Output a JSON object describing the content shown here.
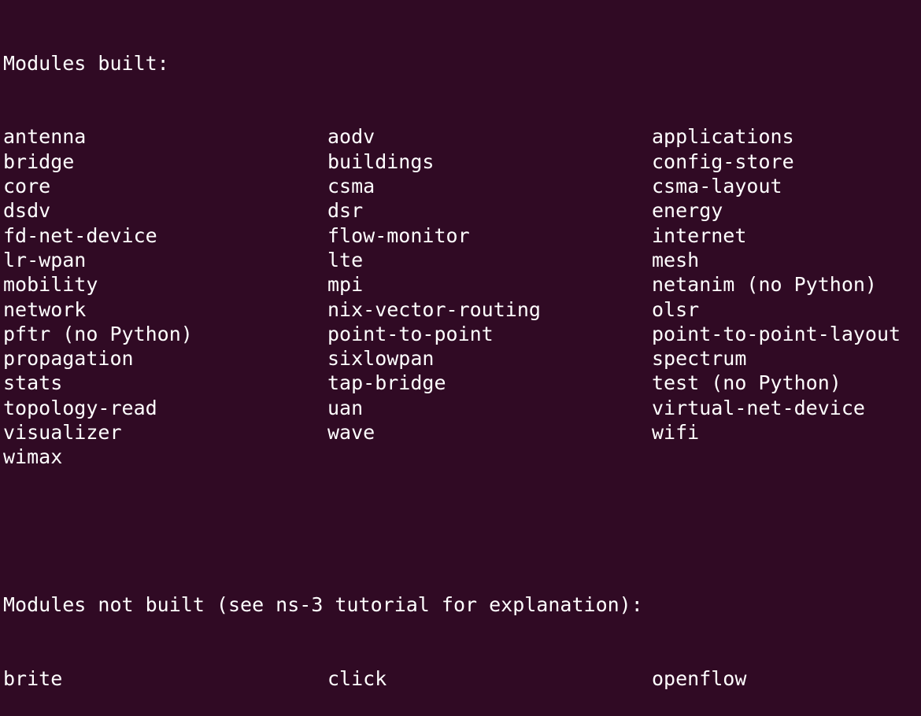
{
  "terminal": {
    "built_header": "Modules built:",
    "built_rows": [
      [
        "antenna",
        "aodv",
        "applications"
      ],
      [
        "bridge",
        "buildings",
        "config-store"
      ],
      [
        "core",
        "csma",
        "csma-layout"
      ],
      [
        "dsdv",
        "dsr",
        "energy"
      ],
      [
        "fd-net-device",
        "flow-monitor",
        "internet"
      ],
      [
        "lr-wpan",
        "lte",
        "mesh"
      ],
      [
        "mobility",
        "mpi",
        "netanim (no Python)"
      ],
      [
        "network",
        "nix-vector-routing",
        "olsr"
      ],
      [
        "pftr (no Python)",
        "point-to-point",
        "point-to-point-layout"
      ],
      [
        "propagation",
        "sixlowpan",
        "spectrum"
      ],
      [
        "stats",
        "tap-bridge",
        "test (no Python)"
      ],
      [
        "topology-read",
        "uan",
        "virtual-net-device"
      ],
      [
        "visualizer",
        "wave",
        "wifi"
      ],
      [
        "wimax",
        "",
        ""
      ]
    ],
    "not_built_header": "Modules not built (see ns-3 tutorial for explanation):",
    "not_built_rows": [
      [
        "brite",
        "click",
        "openflow"
      ]
    ],
    "colors": {
      "background": "#300a24",
      "text": "#ffffff"
    }
  }
}
